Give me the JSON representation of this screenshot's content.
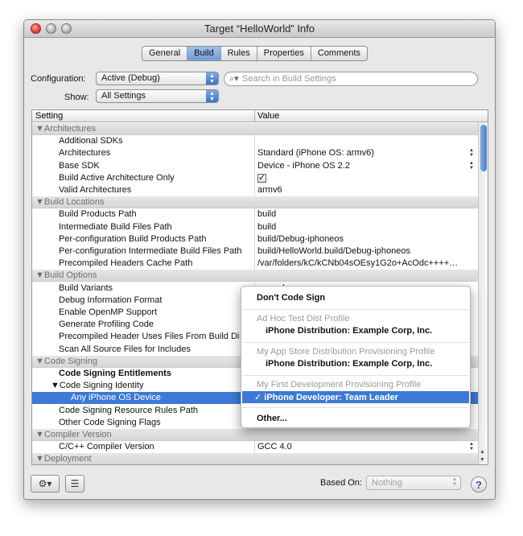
{
  "window": {
    "title": "Target “HelloWorld” Info"
  },
  "tabs": [
    "General",
    "Build",
    "Rules",
    "Properties",
    "Comments"
  ],
  "config": {
    "configuration_label": "Configuration:",
    "configuration_value": "Active (Debug)",
    "show_label": "Show:",
    "show_value": "All Settings",
    "search_placeholder": "Search in Build Settings"
  },
  "table": {
    "header_setting": "Setting",
    "header_value": "Value",
    "rows": [
      {
        "type": "group",
        "label": "▼Architectures"
      },
      {
        "type": "item",
        "setting": "Additional SDKs",
        "value": ""
      },
      {
        "type": "item",
        "setting": "Architectures",
        "value": "Standard (iPhone OS: armv6)",
        "stepper": true
      },
      {
        "type": "item",
        "setting": "Base SDK",
        "value": "Device - iPhone OS 2.2",
        "stepper": true
      },
      {
        "type": "item",
        "setting": "Build Active Architecture Only",
        "value": "",
        "checkbox": true
      },
      {
        "type": "item",
        "setting": "Valid Architectures",
        "value": "armv6"
      },
      {
        "type": "group",
        "label": "▼Build Locations"
      },
      {
        "type": "item",
        "setting": "Build Products Path",
        "value": "build"
      },
      {
        "type": "item",
        "setting": "Intermediate Build Files Path",
        "value": "build"
      },
      {
        "type": "item",
        "setting": "Per-configuration Build Products Path",
        "value": "build/Debug-iphoneos"
      },
      {
        "type": "item",
        "setting": "Per-configuration Intermediate Build Files Path",
        "value": "build/HelloWorld.build/Debug-iphoneos"
      },
      {
        "type": "item",
        "setting": "Precompiled Headers Cache Path",
        "value": "/var/folders/kC/kCNb04sOEsy1G2o+AcOdc++++…"
      },
      {
        "type": "group",
        "label": "▼Build Options"
      },
      {
        "type": "item",
        "setting": "Build Variants",
        "value": "normal"
      },
      {
        "type": "item",
        "setting": "Debug Information Format",
        "value": ""
      },
      {
        "type": "item",
        "setting": "Enable OpenMP Support",
        "value": ""
      },
      {
        "type": "item",
        "setting": "Generate Profiling Code",
        "value": ""
      },
      {
        "type": "item",
        "setting": "Precompiled Header Uses Files From Build Di",
        "value": ""
      },
      {
        "type": "item",
        "setting": "Scan All Source Files for Includes",
        "value": ""
      },
      {
        "type": "group",
        "label": "▼Code Signing"
      },
      {
        "type": "item",
        "setting": "Code Signing Entitlements",
        "value": "",
        "bold": true
      },
      {
        "type": "item",
        "setting": "▼Code Signing Identity",
        "value": "",
        "outdent": true
      },
      {
        "type": "item",
        "setting": "Any iPhone OS Device",
        "value": "",
        "selected": true,
        "indent": true
      },
      {
        "type": "item",
        "setting": "Code Signing Resource Rules Path",
        "value": ""
      },
      {
        "type": "item",
        "setting": "Other Code Signing Flags",
        "value": ""
      },
      {
        "type": "group",
        "label": "▼Compiler Version"
      },
      {
        "type": "item",
        "setting": "C/C++ Compiler Version",
        "value": "GCC 4.0",
        "stepper": true
      },
      {
        "type": "group",
        "label": "▼Deployment"
      }
    ]
  },
  "menu": {
    "dont_sign": "Don't Code Sign",
    "adhoc_header": "Ad Hoc Test Dist Profile",
    "adhoc_item": "iPhone Distribution: Example Corp, Inc.",
    "appstore_header": "My App Store Distribution Provisioning Profile",
    "appstore_item": "iPhone Distribution: Example Corp, Inc.",
    "dev_header": "My First Development Provisioning Profile",
    "dev_item": "✓ iPhone Developer: Team Leader",
    "other": "Other..."
  },
  "bottom": {
    "based_on_label": "Based On:",
    "based_on_value": "Nothing",
    "help": "?"
  },
  "colors": {
    "selection": "#3d79d6",
    "accent": "#6e9bd6"
  }
}
